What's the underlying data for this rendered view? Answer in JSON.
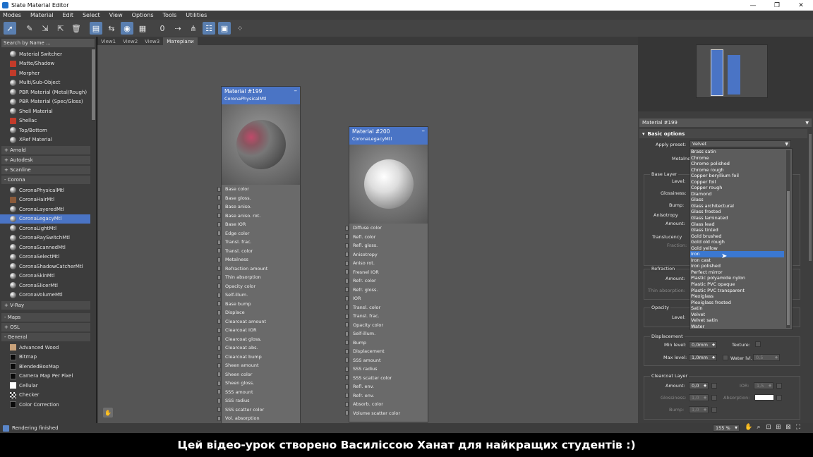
{
  "window": {
    "title": "Slate Material Editor",
    "buttons": [
      "—",
      "❐",
      "✕"
    ]
  },
  "menu": [
    "Modes",
    "Material",
    "Edit",
    "Select",
    "View",
    "Options",
    "Tools",
    "Utilities"
  ],
  "toolbar_icons": [
    "select-arrow-icon",
    "eyedropper-icon",
    "assign-material-icon",
    "put-to-scene-icon",
    "delete-icon",
    "move-children-icon",
    "layout-icon",
    "sphere-preview-icon",
    "checker-background-icon",
    "material-id-icon",
    "show-end-result-icon",
    "show-map-icon",
    "layout-all-icon",
    "background-toggle-icon",
    "bake-icon"
  ],
  "left": {
    "search_placeholder": "Search by Name ...",
    "top_items": [
      {
        "label": "Material Switcher",
        "icon": "sphere"
      },
      {
        "label": "Matte/Shadow",
        "icon": "red"
      },
      {
        "label": "Morpher",
        "icon": "red"
      },
      {
        "label": "Multi/Sub-Object",
        "icon": "sphere"
      },
      {
        "label": "PBR Material (Metal/Rough)",
        "icon": "sphere"
      },
      {
        "label": "PBR Material (Spec/Gloss)",
        "icon": "sphere"
      },
      {
        "label": "Shell Material",
        "icon": "sphere"
      },
      {
        "label": "Shellac",
        "icon": "red"
      },
      {
        "label": "Top/Bottom",
        "icon": "sphere"
      },
      {
        "label": "XRef Material",
        "icon": "sphere"
      }
    ],
    "groups": [
      "+ Arnold",
      "+ Autodesk",
      "+ Scanline",
      "- Corona"
    ],
    "corona_items": [
      {
        "label": "CoronaPhysicalMtl",
        "icon": "sphere"
      },
      {
        "label": "CoronaHairMtl",
        "icon": "hair"
      },
      {
        "label": "CoronaLayeredMtl",
        "icon": "sphere"
      },
      {
        "label": "CoronaLegacyMtl",
        "icon": "sphere",
        "selected": true
      },
      {
        "label": "CoronaLightMtl",
        "icon": "sphere"
      },
      {
        "label": "CoronaRaySwitchMtl",
        "icon": "sphere"
      },
      {
        "label": "CoronaScannedMtl",
        "icon": "sphere"
      },
      {
        "label": "CoronaSelectMtl",
        "icon": "sphere"
      },
      {
        "label": "CoronaShadowCatcherMtl",
        "icon": "sphere"
      },
      {
        "label": "CoronaSkinMtl",
        "icon": "sphere"
      },
      {
        "label": "CoronaSlicerMtl",
        "icon": "sphere"
      },
      {
        "label": "CoronaVolumeMtl",
        "icon": "sphere"
      }
    ],
    "vray": "+ V-Ray",
    "maps": "- Maps",
    "osl": "+ OSL",
    "general": "- General",
    "map_items": [
      {
        "label": "Advanced Wood",
        "icon": "tan"
      },
      {
        "label": "Bitmap",
        "icon": "blk"
      },
      {
        "label": "BlendedBoxMap",
        "icon": "blk"
      },
      {
        "label": "Camera Map Per Pixel",
        "icon": "blk"
      },
      {
        "label": "Cellular",
        "icon": "sq"
      },
      {
        "label": "Checker",
        "icon": "chk"
      },
      {
        "label": "Color Correction",
        "icon": "blk"
      }
    ]
  },
  "view_tabs": [
    "View1",
    "View2",
    "View3",
    "Матеріали"
  ],
  "node1": {
    "title": "Material #199",
    "subtitle": "CoronaPhysicalMtl",
    "slots": [
      "Base color",
      "Base gloss.",
      "Base aniso.",
      "Base aniso. rot.",
      "Base IOR",
      "Edge color",
      "Transl. frac.",
      "Transl. color",
      "Metalness",
      "Refraction amount",
      "Thin absorption",
      "Opacity color",
      "Self-illum.",
      "Base bump",
      "Displace",
      "Clearcoat amount",
      "Clearcoat IOR",
      "Clearcoat gloss.",
      "Clearcoat abs.",
      "Clearcoat bump",
      "Sheen amount",
      "Sheen color",
      "Sheen gloss.",
      "SSS amount",
      "SSS radius",
      "SSS scatter color",
      "Vol. absorption"
    ]
  },
  "node2": {
    "title": "Material #200",
    "subtitle": "CoronaLegacyMtl",
    "slots": [
      "Diffuse color",
      "Refl. color",
      "Refl. gloss.",
      "Anisotropy",
      "Aniso rot.",
      "Fresnel IOR",
      "Refr. color",
      "Refr. gloss.",
      "IOR",
      "Transl. color",
      "Transl. frac.",
      "Opacity color",
      "Self-illum.",
      "Bump",
      "Displacement",
      "SSS amount",
      "SSS radius",
      "SSS scatter color",
      "Refl. env.",
      "Refr. env.",
      "Absorb. color",
      "Volume scatter color"
    ]
  },
  "node_minimize": "–",
  "right": {
    "material_name": "Material #199",
    "rollout": "Basic options",
    "apply_preset_label": "Apply preset:",
    "apply_preset_value": "Velvet",
    "labels": {
      "metalness": "Metalness:",
      "base_layer": "Base Layer",
      "level": "Level:",
      "glossiness": "Glossiness:",
      "bump": "Bump:",
      "anisotropy": "Anisotropy",
      "amount": "Amount:",
      "translucency": "Translucency",
      "fraction": "Fraction:",
      "refraction": "Refraction",
      "thin_absorption": "Thin absorption:",
      "opacity": "Opacity",
      "displacement": "Displacement",
      "min_level": "Min level:",
      "max_level": "Max level:",
      "texture": "Texture:",
      "water_lvl": "Water lvl.",
      "clearcoat": "Clearcoat Layer",
      "ior": "IOR:",
      "absorption": "Absorption:"
    },
    "values": {
      "min_level": "0,0mm",
      "max_level": "1,0mm",
      "water_lvl": "0,5",
      "cc_amount": "0,0",
      "cc_ior": "1,5",
      "cc_gloss": "1,0",
      "cc_bump": "1,0"
    },
    "preset_options": [
      "Brass satin",
      "Chrome",
      "Chrome polished",
      "Chrome rough",
      "Copper beryllium foil",
      "Copper foil",
      "Copper rough",
      "Diamond",
      "Glass",
      "Glass architectural",
      "Glass frosted",
      "Glass laminated",
      "Glass lead",
      "Glass tinted",
      "Gold brushed",
      "Gold old rough",
      "Gold yellow",
      "Iron",
      "Iron cast",
      "Iron polished",
      "Perfect mirror",
      "Plastic polyamide nylon",
      "Plastic PVC opaque",
      "Plastic PVC transparent",
      "Plexiglass",
      "Plexiglass frosted",
      "Satin",
      "Velvet",
      "Velvet satin",
      "Water"
    ],
    "hovered_option": "Iron"
  },
  "status": {
    "text": "Rendering finished",
    "zoom": "155 %"
  },
  "caption": "Цей відео-урок створено Василіссою Ханат для найкращих студентів :)",
  "colors": {
    "accent": "#4a74c5",
    "panel": "#3e3e3e",
    "canvas": "#555555"
  }
}
